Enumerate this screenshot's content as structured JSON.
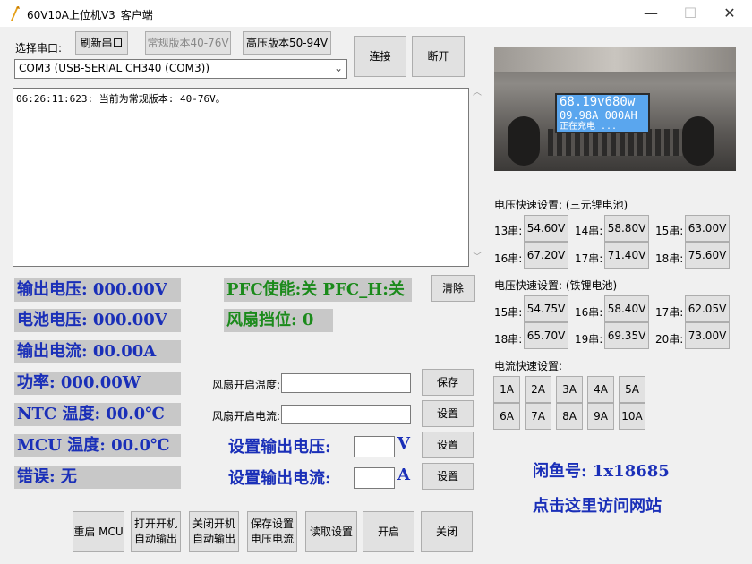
{
  "window": {
    "title": "60V10A上位机V3_客户端",
    "minimize": "—",
    "maximize": "☐",
    "close": "✕"
  },
  "serial": {
    "label": "选择串口:",
    "refresh": "刷新串口",
    "std_version": "常规版本40-76V",
    "hv_version": "高压版本50-94V",
    "connect": "连接",
    "disconnect": "断开",
    "port": "COM3 (USB-SERIAL CH340 (COM3))"
  },
  "log": {
    "line": "06:26:11:623: 当前为常规版本: 40-76V。"
  },
  "status": {
    "out_voltage": "输出电压: 000.00V",
    "bat_voltage": "电池电压: 000.00V",
    "out_current": "输出电流:  00.00A",
    "power": "功率:     000.00W",
    "ntc_temp": "NTC 温度:  00.0℃",
    "mcu_temp": "MCU 温度:  00.0℃",
    "error": "错误: 无",
    "pfc": "PFC使能:关 PFC_H:关",
    "fan_level": "风扇挡位: 0",
    "clear": "清除"
  },
  "fan": {
    "temp_label": "风扇开启温度:",
    "current_label": "风扇开启电流:",
    "save": "保存",
    "set": "设置",
    "temp_value": "",
    "current_value": ""
  },
  "output_set": {
    "voltage_label": "设置输出电压:",
    "voltage_unit": "V",
    "current_label": "设置输出电流:",
    "current_unit": "A",
    "set": "设置",
    "voltage_value": "",
    "current_value": ""
  },
  "bottom": {
    "restart": "重启 MCU",
    "auto_on": "打开开机 自动输出",
    "auto_off": "关闭开机 自动输出",
    "save_vi": "保存设置 电压电流",
    "read": "读取设置",
    "on": "开启",
    "off": "关闭"
  },
  "device_image": {
    "screen_lines": [
      "68.19v680w",
      "09.98A 000AH",
      "正在充电 ..."
    ]
  },
  "ternary": {
    "title": "电压快速设置: (三元锂电池)",
    "rows": [
      [
        {
          "label": "13串:",
          "value": "54.60V"
        },
        {
          "label": "14串:",
          "value": "58.80V"
        },
        {
          "label": "15串:",
          "value": "63.00V"
        }
      ],
      [
        {
          "label": "16串:",
          "value": "67.20V"
        },
        {
          "label": "17串:",
          "value": "71.40V"
        },
        {
          "label": "18串:",
          "value": "75.60V"
        }
      ]
    ]
  },
  "lfp": {
    "title": "电压快速设置: (铁锂电池)",
    "rows": [
      [
        {
          "label": "15串:",
          "value": "54.75V"
        },
        {
          "label": "16串:",
          "value": "58.40V"
        },
        {
          "label": "17串:",
          "value": "62.05V"
        }
      ],
      [
        {
          "label": "18串:",
          "value": "65.70V"
        },
        {
          "label": "19串:",
          "value": "69.35V"
        },
        {
          "label": "20串:",
          "value": "73.00V"
        }
      ]
    ]
  },
  "current_quick": {
    "title": "电流快速设置:",
    "row1": [
      "1A",
      "2A",
      "3A",
      "4A",
      "5A"
    ],
    "row2": [
      "6A",
      "7A",
      "8A",
      "9A",
      "10A"
    ]
  },
  "promo": {
    "xianyu": "闲鱼号: 1x18685",
    "visit": "点击这里访问网站"
  }
}
